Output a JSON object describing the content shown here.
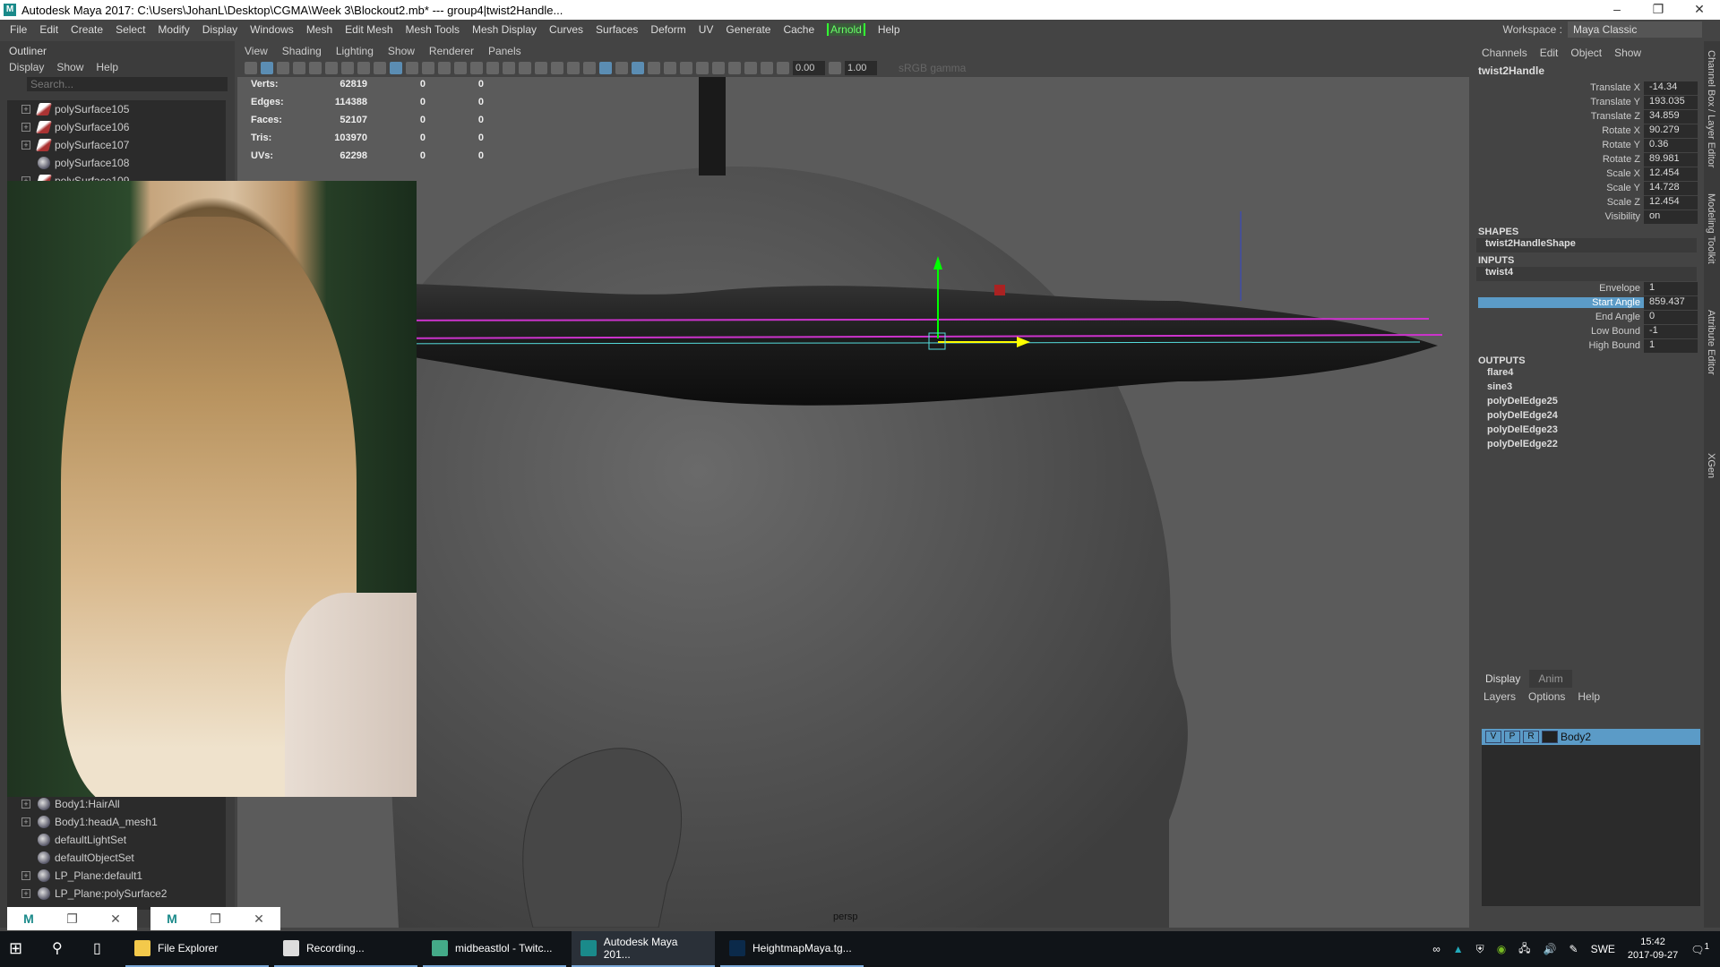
{
  "window": {
    "title": "Autodesk Maya 2017: C:\\Users\\JohanL\\Desktop\\CGMA\\Week 3\\Blockout2.mb*  ---  group4|twist2Handle...",
    "controls": [
      "–",
      "❐",
      "✕"
    ]
  },
  "menubar": [
    "File",
    "Edit",
    "Create",
    "Select",
    "Modify",
    "Display",
    "Windows",
    "Mesh",
    "Edit Mesh",
    "Mesh Tools",
    "Mesh Display",
    "Curves",
    "Surfaces",
    "Deform",
    "UV",
    "Generate",
    "Cache",
    "Arnold",
    "Help"
  ],
  "workspace": {
    "label": "Workspace :",
    "value": "Maya Classic"
  },
  "outliner": {
    "title": "Outliner",
    "menu": [
      "Display",
      "Show",
      "Help"
    ],
    "search_placeholder": "Search...",
    "top_items": [
      {
        "label": "polySurface105",
        "type": "mesh",
        "expand": true
      },
      {
        "label": "polySurface106",
        "type": "mesh",
        "expand": true
      },
      {
        "label": "polySurface107",
        "type": "mesh",
        "expand": true
      },
      {
        "label": "polySurface108",
        "type": "group",
        "expand": false
      },
      {
        "label": "polySurface109",
        "type": "mesh",
        "expand": true
      }
    ],
    "bottom_items": [
      {
        "label": "Body1:HairAll",
        "expand": true
      },
      {
        "label": "Body1:headA_mesh1",
        "expand": true
      },
      {
        "label": "defaultLightSet",
        "expand": false
      },
      {
        "label": "defaultObjectSet",
        "expand": false
      },
      {
        "label": "LP_Plane:default1",
        "expand": true
      },
      {
        "label": "LP_Plane:polySurface2",
        "expand": true
      }
    ]
  },
  "viewport": {
    "menu": [
      "View",
      "Shading",
      "Lighting",
      "Show",
      "Renderer",
      "Panels"
    ],
    "exposure": "0.00",
    "gamma": "1.00",
    "colorspace": "sRGB gamma",
    "camera": "persp",
    "hud": [
      {
        "k": "Verts:",
        "v": "62819",
        "a": "0",
        "b": "0"
      },
      {
        "k": "Edges:",
        "v": "114388",
        "a": "0",
        "b": "0"
      },
      {
        "k": "Faces:",
        "v": "52107",
        "a": "0",
        "b": "0"
      },
      {
        "k": "Tris:",
        "v": "103970",
        "a": "0",
        "b": "0"
      },
      {
        "k": "UVs:",
        "v": "62298",
        "a": "0",
        "b": "0"
      }
    ]
  },
  "channelbox": {
    "menu": [
      "Channels",
      "Edit",
      "Object",
      "Show"
    ],
    "node": "twist2Handle",
    "attrs": [
      {
        "n": "Translate X",
        "v": "-14.34"
      },
      {
        "n": "Translate Y",
        "v": "193.035"
      },
      {
        "n": "Translate Z",
        "v": "34.859"
      },
      {
        "n": "Rotate X",
        "v": "90.279"
      },
      {
        "n": "Rotate Y",
        "v": "0.36"
      },
      {
        "n": "Rotate Z",
        "v": "89.981"
      },
      {
        "n": "Scale X",
        "v": "12.454"
      },
      {
        "n": "Scale Y",
        "v": "14.728"
      },
      {
        "n": "Scale Z",
        "v": "12.454"
      },
      {
        "n": "Visibility",
        "v": "on"
      }
    ],
    "shapes_label": "SHAPES",
    "shape": "twist2HandleShape",
    "inputs_label": "INPUTS",
    "input": "twist4",
    "input_attrs": [
      {
        "n": "Envelope",
        "v": "1"
      },
      {
        "n": "Start Angle",
        "v": "859.437",
        "selected": true
      },
      {
        "n": "End Angle",
        "v": "0"
      },
      {
        "n": "Low Bound",
        "v": "-1"
      },
      {
        "n": "High Bound",
        "v": "1"
      }
    ],
    "outputs_label": "OUTPUTS",
    "outputs": [
      "flare4",
      "sine3",
      "polyDelEdge25",
      "polyDelEdge24",
      "polyDelEdge23",
      "polyDelEdge22"
    ]
  },
  "side_tabs": [
    "Channel Box / Layer Editor",
    "Modeling Toolkit",
    "Attribute Editor",
    "XGen"
  ],
  "layers": {
    "tabs": [
      "Display",
      "Anim"
    ],
    "menu": [
      "Layers",
      "Options",
      "Help"
    ],
    "layer": {
      "v": "V",
      "p": "P",
      "r": "R",
      "name": "Body2"
    }
  },
  "taskbar": {
    "apps": [
      "File Explorer",
      "Recording...",
      "midbeastlol - Twitc...",
      "Autodesk Maya 201...",
      "HeightmapMaya.tg..."
    ],
    "lang": "SWE",
    "time": "15:42",
    "date": "2017-09-27",
    "notifications": "1"
  },
  "colors": {
    "accent": "#5b9bc7",
    "arnold": "#33ff33",
    "manip_green": "#00ff00",
    "manip_yellow": "#ffff00",
    "magenta": "#cc33cc"
  }
}
